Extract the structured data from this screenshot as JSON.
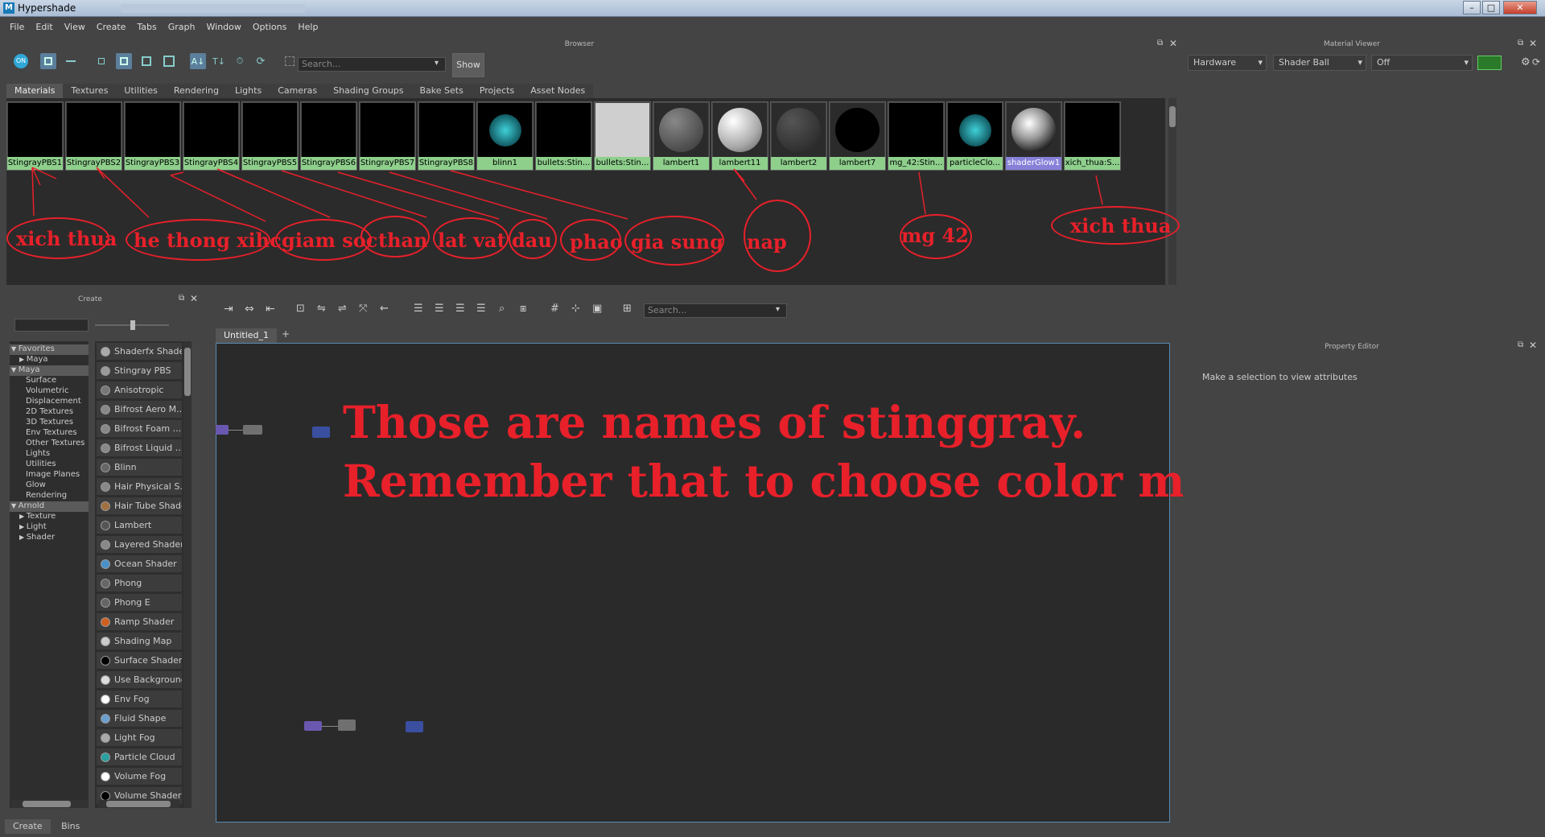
{
  "window": {
    "title": "Hypershade",
    "app_icon": "M"
  },
  "menu": [
    "File",
    "Edit",
    "View",
    "Create",
    "Tabs",
    "Graph",
    "Window",
    "Options",
    "Help"
  ],
  "browser": {
    "panel_title": "Browser",
    "search_placeholder": "Search...",
    "show_label": "Show",
    "tabs": [
      "Materials",
      "Textures",
      "Utilities",
      "Rendering",
      "Lights",
      "Cameras",
      "Shading Groups",
      "Bake Sets",
      "Projects",
      "Asset Nodes"
    ],
    "materials": [
      {
        "label": "StingrayPBS1",
        "look": "black"
      },
      {
        "label": "StingrayPBS2",
        "look": "black"
      },
      {
        "label": "StingrayPBS3",
        "look": "black"
      },
      {
        "label": "StingrayPBS4",
        "look": "black"
      },
      {
        "label": "StingrayPBS5",
        "look": "black"
      },
      {
        "label": "StingrayPBS6",
        "look": "black"
      },
      {
        "label": "StingrayPBS7",
        "look": "black"
      },
      {
        "label": "StingrayPBS8",
        "look": "black"
      },
      {
        "label": "blinn1",
        "look": "teal-checker"
      },
      {
        "label": "bullets:Stin...",
        "look": "black"
      },
      {
        "label": "bullets:Stin...",
        "look": "gray"
      },
      {
        "label": "lambert1",
        "look": "ball-gray"
      },
      {
        "label": "lambert11",
        "look": "ball-white"
      },
      {
        "label": "lambert2",
        "look": "ball-dark"
      },
      {
        "label": "lambert7",
        "look": "ball-black"
      },
      {
        "label": "mg_42:Stin...",
        "look": "black"
      },
      {
        "label": "particleClo...",
        "look": "teal-checker"
      },
      {
        "label": "shaderGlow1",
        "look": "ball-glow"
      },
      {
        "label": "xich_thua:S...",
        "look": "black"
      }
    ],
    "annotations": [
      "xich thua",
      "he thong xihc",
      "giam soc",
      "than",
      "lat vat",
      "dau",
      "phao",
      "gia sung",
      "nap",
      "mg 42",
      "xich thua"
    ]
  },
  "create": {
    "panel_title": "Create",
    "tree": [
      {
        "label": "Favorites",
        "hdr": true,
        "arrow": "▼"
      },
      {
        "label": "Maya",
        "arrow": "▶",
        "indent": 1
      },
      {
        "label": "Maya",
        "hdr": true,
        "arrow": "▼"
      },
      {
        "label": "Surface",
        "indent": 2
      },
      {
        "label": "Volumetric",
        "indent": 2
      },
      {
        "label": "Displacement",
        "indent": 2
      },
      {
        "label": "2D Textures",
        "indent": 2
      },
      {
        "label": "3D Textures",
        "indent": 2
      },
      {
        "label": "Env Textures",
        "indent": 2
      },
      {
        "label": "Other Textures",
        "indent": 2
      },
      {
        "label": "Lights",
        "indent": 2
      },
      {
        "label": "Utilities",
        "indent": 2
      },
      {
        "label": "Image Planes",
        "indent": 2
      },
      {
        "label": "Glow",
        "indent": 2
      },
      {
        "label": "Rendering",
        "indent": 2
      },
      {
        "label": "Arnold",
        "hdr": true,
        "arrow": "▼"
      },
      {
        "label": "Texture",
        "arrow": "▶",
        "indent": 1
      },
      {
        "label": "Light",
        "arrow": "▶",
        "indent": 1
      },
      {
        "label": "Shader",
        "arrow": "▶",
        "indent": 1
      }
    ],
    "nodes": [
      {
        "label": "Shaderfx Shader",
        "color": "#aaaaaa"
      },
      {
        "label": "Stingray PBS",
        "color": "#9a9a9a"
      },
      {
        "label": "Anisotropic",
        "color": "#777777"
      },
      {
        "label": "Bifrost Aero M...",
        "color": "#888888"
      },
      {
        "label": "Bifrost Foam ...",
        "color": "#888888"
      },
      {
        "label": "Bifrost Liquid ...",
        "color": "#888888"
      },
      {
        "label": "Blinn",
        "color": "#666666"
      },
      {
        "label": "Hair Physical S...",
        "color": "#888888"
      },
      {
        "label": "Hair Tube Shade",
        "color": "#a07040"
      },
      {
        "label": "Lambert",
        "color": "#555555"
      },
      {
        "label": "Layered Shader",
        "color": "#888888"
      },
      {
        "label": "Ocean Shader",
        "color": "#4a90c8"
      },
      {
        "label": "Phong",
        "color": "#666666"
      },
      {
        "label": "Phong E",
        "color": "#666666"
      },
      {
        "label": "Ramp Shader",
        "color": "#d06020"
      },
      {
        "label": "Shading Map",
        "color": "#cccccc"
      },
      {
        "label": "Surface Shader",
        "color": "#000000"
      },
      {
        "label": "Use Background",
        "color": "#dddddd"
      },
      {
        "label": "Env Fog",
        "color": "#ffffff"
      },
      {
        "label": "Fluid Shape",
        "color": "#6aa0d0"
      },
      {
        "label": "Light Fog",
        "color": "#aaaaaa"
      },
      {
        "label": "Particle Cloud",
        "color": "#2aa0a0"
      },
      {
        "label": "Volume Fog",
        "color": "#ffffff"
      },
      {
        "label": "Volume Shader",
        "color": "#000000"
      }
    ],
    "bottom_tabs": [
      "Create",
      "Bins"
    ]
  },
  "graph": {
    "search_placeholder": "Search...",
    "tab": "Untitled_1",
    "add_tab": "+",
    "note_line1": "Those are names of stinggray.",
    "note_line2": "Remember that to choose color map"
  },
  "material_viewer": {
    "panel_title": "Material Viewer",
    "renderer": "Hardware",
    "shape": "Shader Ball",
    "env": "Off"
  },
  "property_editor": {
    "panel_title": "Property Editor",
    "message": "Make a selection to view attributes"
  }
}
